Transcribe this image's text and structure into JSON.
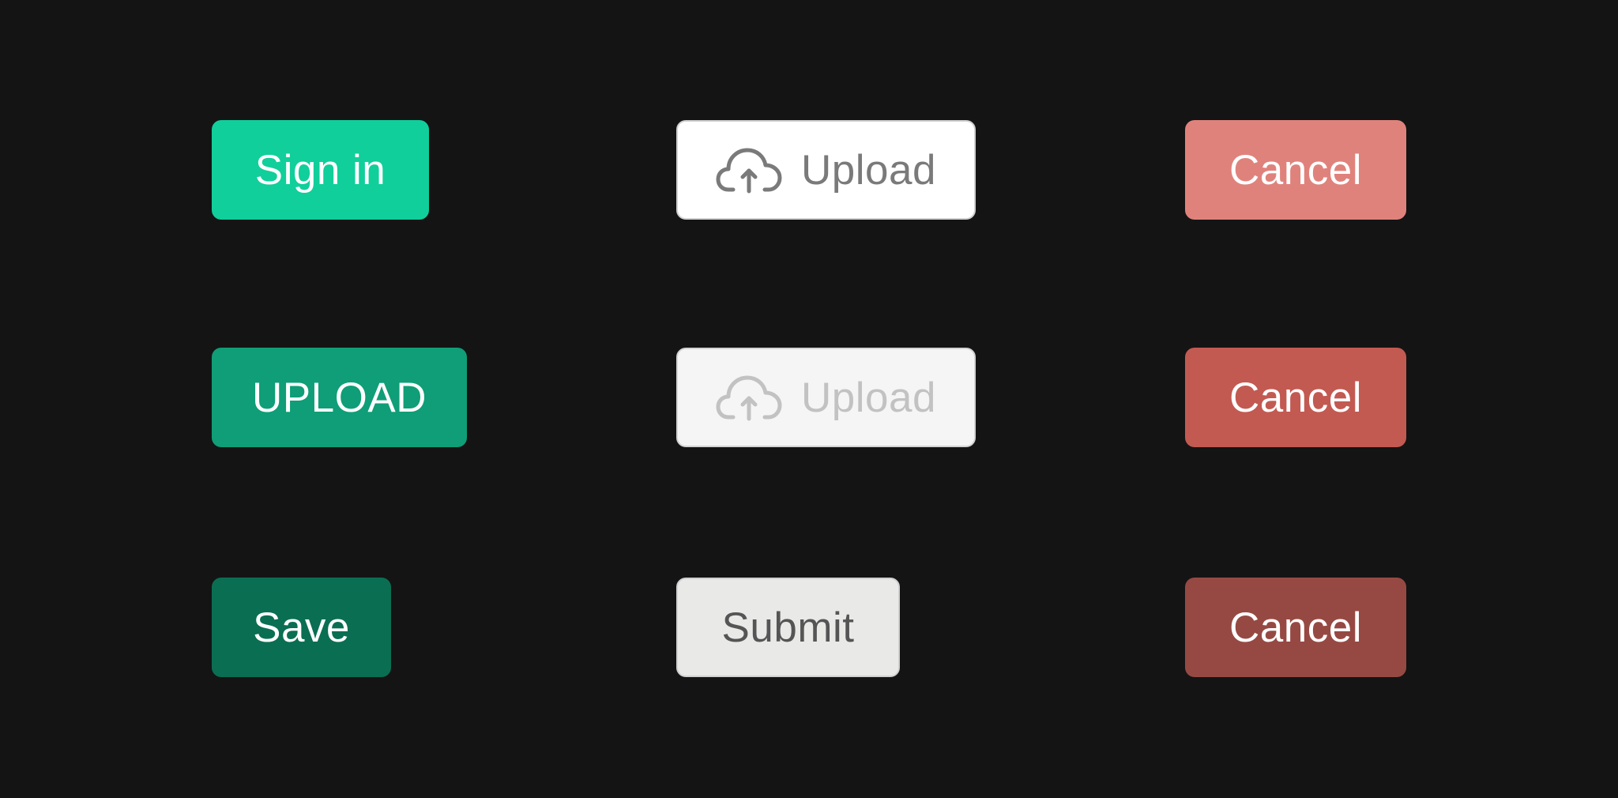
{
  "buttons": {
    "sign_in": {
      "label": "Sign in",
      "bg": "#10cf9b",
      "fg": "#ffffff"
    },
    "upload_caps": {
      "label": "UPLOAD",
      "bg": "#0f9e77",
      "fg": "#ffffff"
    },
    "save": {
      "label": "Save",
      "bg": "#0a6e52",
      "fg": "#ffffff"
    },
    "upload_default": {
      "label": "Upload",
      "icon": "cloud-upload-icon",
      "bg": "#ffffff",
      "fg": "#7a7a7a"
    },
    "upload_disabled": {
      "label": "Upload",
      "icon": "cloud-upload-icon",
      "bg": "#f5f5f5",
      "fg": "#c2c2c2"
    },
    "submit": {
      "label": "Submit",
      "bg": "#e9eae8",
      "fg": "#555555"
    },
    "cancel_light": {
      "label": "Cancel",
      "bg": "#e0827c",
      "fg": "#ffffff"
    },
    "cancel_medium": {
      "label": "Cancel",
      "bg": "#c25a52",
      "fg": "#ffffff"
    },
    "cancel_dark": {
      "label": "Cancel",
      "bg": "#964943",
      "fg": "#ffffff"
    }
  }
}
